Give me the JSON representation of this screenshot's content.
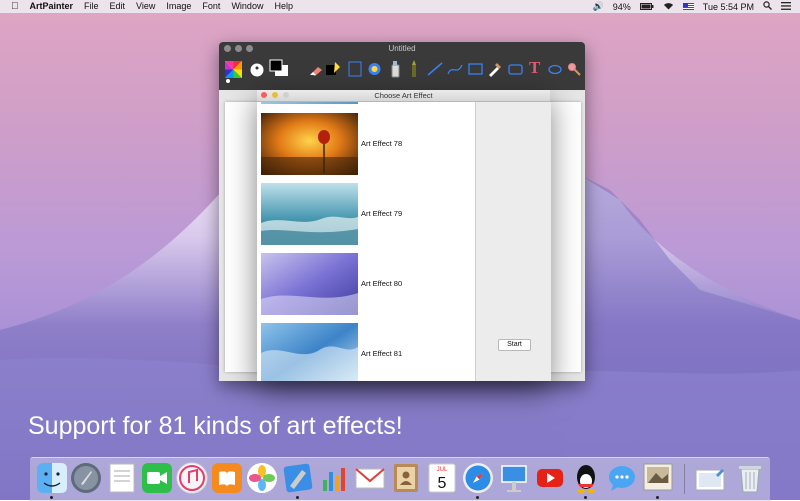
{
  "menubar": {
    "app_name": "ArtPainter",
    "items": [
      "File",
      "Edit",
      "View",
      "Image",
      "Font",
      "Window",
      "Help"
    ],
    "battery": "94%",
    "clock": "Tue 5:54 PM"
  },
  "paint_window": {
    "title": "Untitled"
  },
  "dialog": {
    "title": "Choose Art Effect",
    "start_label": "Start",
    "effects": [
      {
        "label": "Art Effect 78"
      },
      {
        "label": "Art Effect 79"
      },
      {
        "label": "Art Effect 80"
      },
      {
        "label": "Art Effect 81"
      }
    ]
  },
  "caption": "Support for 81 kinds of art effects!",
  "dock": {
    "apps": [
      "finder-icon",
      "launchpad-icon",
      "textedit-icon",
      "facetime-icon",
      "itunes-icon",
      "ibooks-icon",
      "photos-icon",
      "xcode-icon",
      "numbers-icon",
      "mail-icon",
      "contacts-icon",
      "calendar-icon",
      "safari-icon",
      "keynote-icon",
      "youtube-icon",
      "qq-icon",
      "messages-icon",
      "artpainter-icon",
      "preview-icon",
      "trash-icon"
    ],
    "calendar_day": "5",
    "calendar_month": "JUL"
  },
  "colors": {
    "accent": "#3a83f7",
    "window_dark": "#3a3a3a"
  }
}
